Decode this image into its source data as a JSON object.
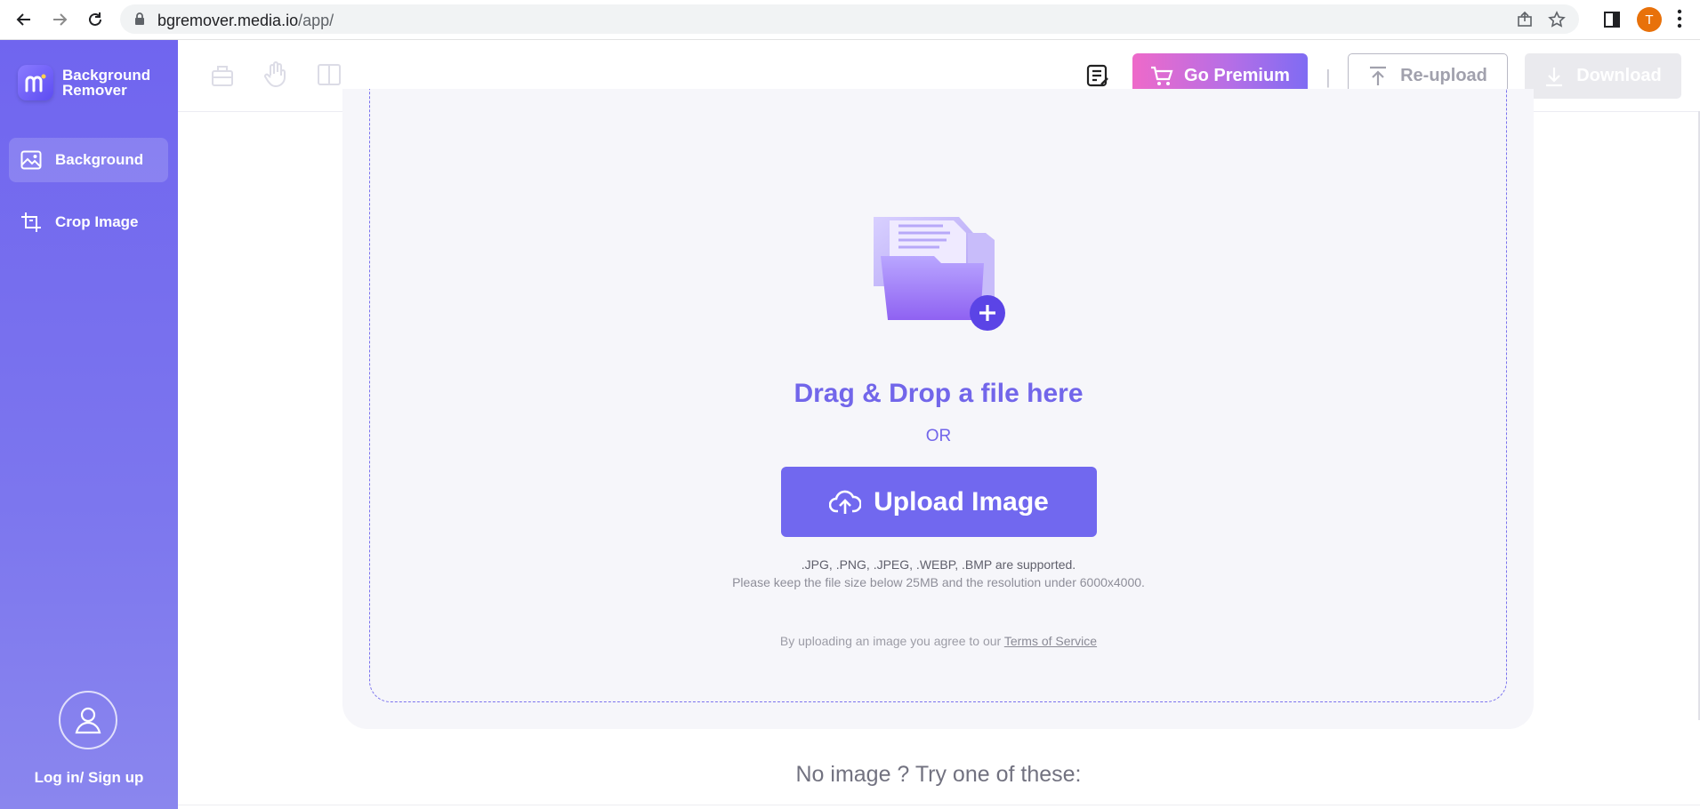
{
  "browser": {
    "url_host": "bgremover.media.io",
    "url_path": "/app/",
    "profile_initial": "T"
  },
  "sidebar": {
    "logo_title": "Background Remover",
    "items": [
      {
        "label": "Background",
        "icon": "image-icon",
        "active": true
      },
      {
        "label": "Crop Image",
        "icon": "crop-icon",
        "active": false
      }
    ],
    "login_label": "Log in/ Sign up"
  },
  "toolbar": {
    "tools": [
      "bucket-tool-icon",
      "hand-tool-icon",
      "compare-tool-icon"
    ],
    "premium_label": "Go Premium",
    "reupload_label": "Re-upload",
    "download_label": "Download",
    "separator": "|"
  },
  "upload": {
    "title": "Drag & Drop a file here",
    "or": "OR",
    "button_label": "Upload Image",
    "formats": ".JPG, .PNG, .JPEG, .WEBP, .BMP are supported.",
    "size_note": "Please keep the file size below 25MB and the resolution under 6000x4000.",
    "tos_prefix": "By uploading an image you agree to our",
    "tos_link": "Terms of Service"
  },
  "samples": {
    "heading": "No image ? Try one of these:"
  },
  "colors": {
    "accent": "#7168ef",
    "sidebar_top": "#7065ef",
    "premium_gradient_start": "#ee6ac9",
    "premium_gradient_end": "#7f6cf3"
  }
}
